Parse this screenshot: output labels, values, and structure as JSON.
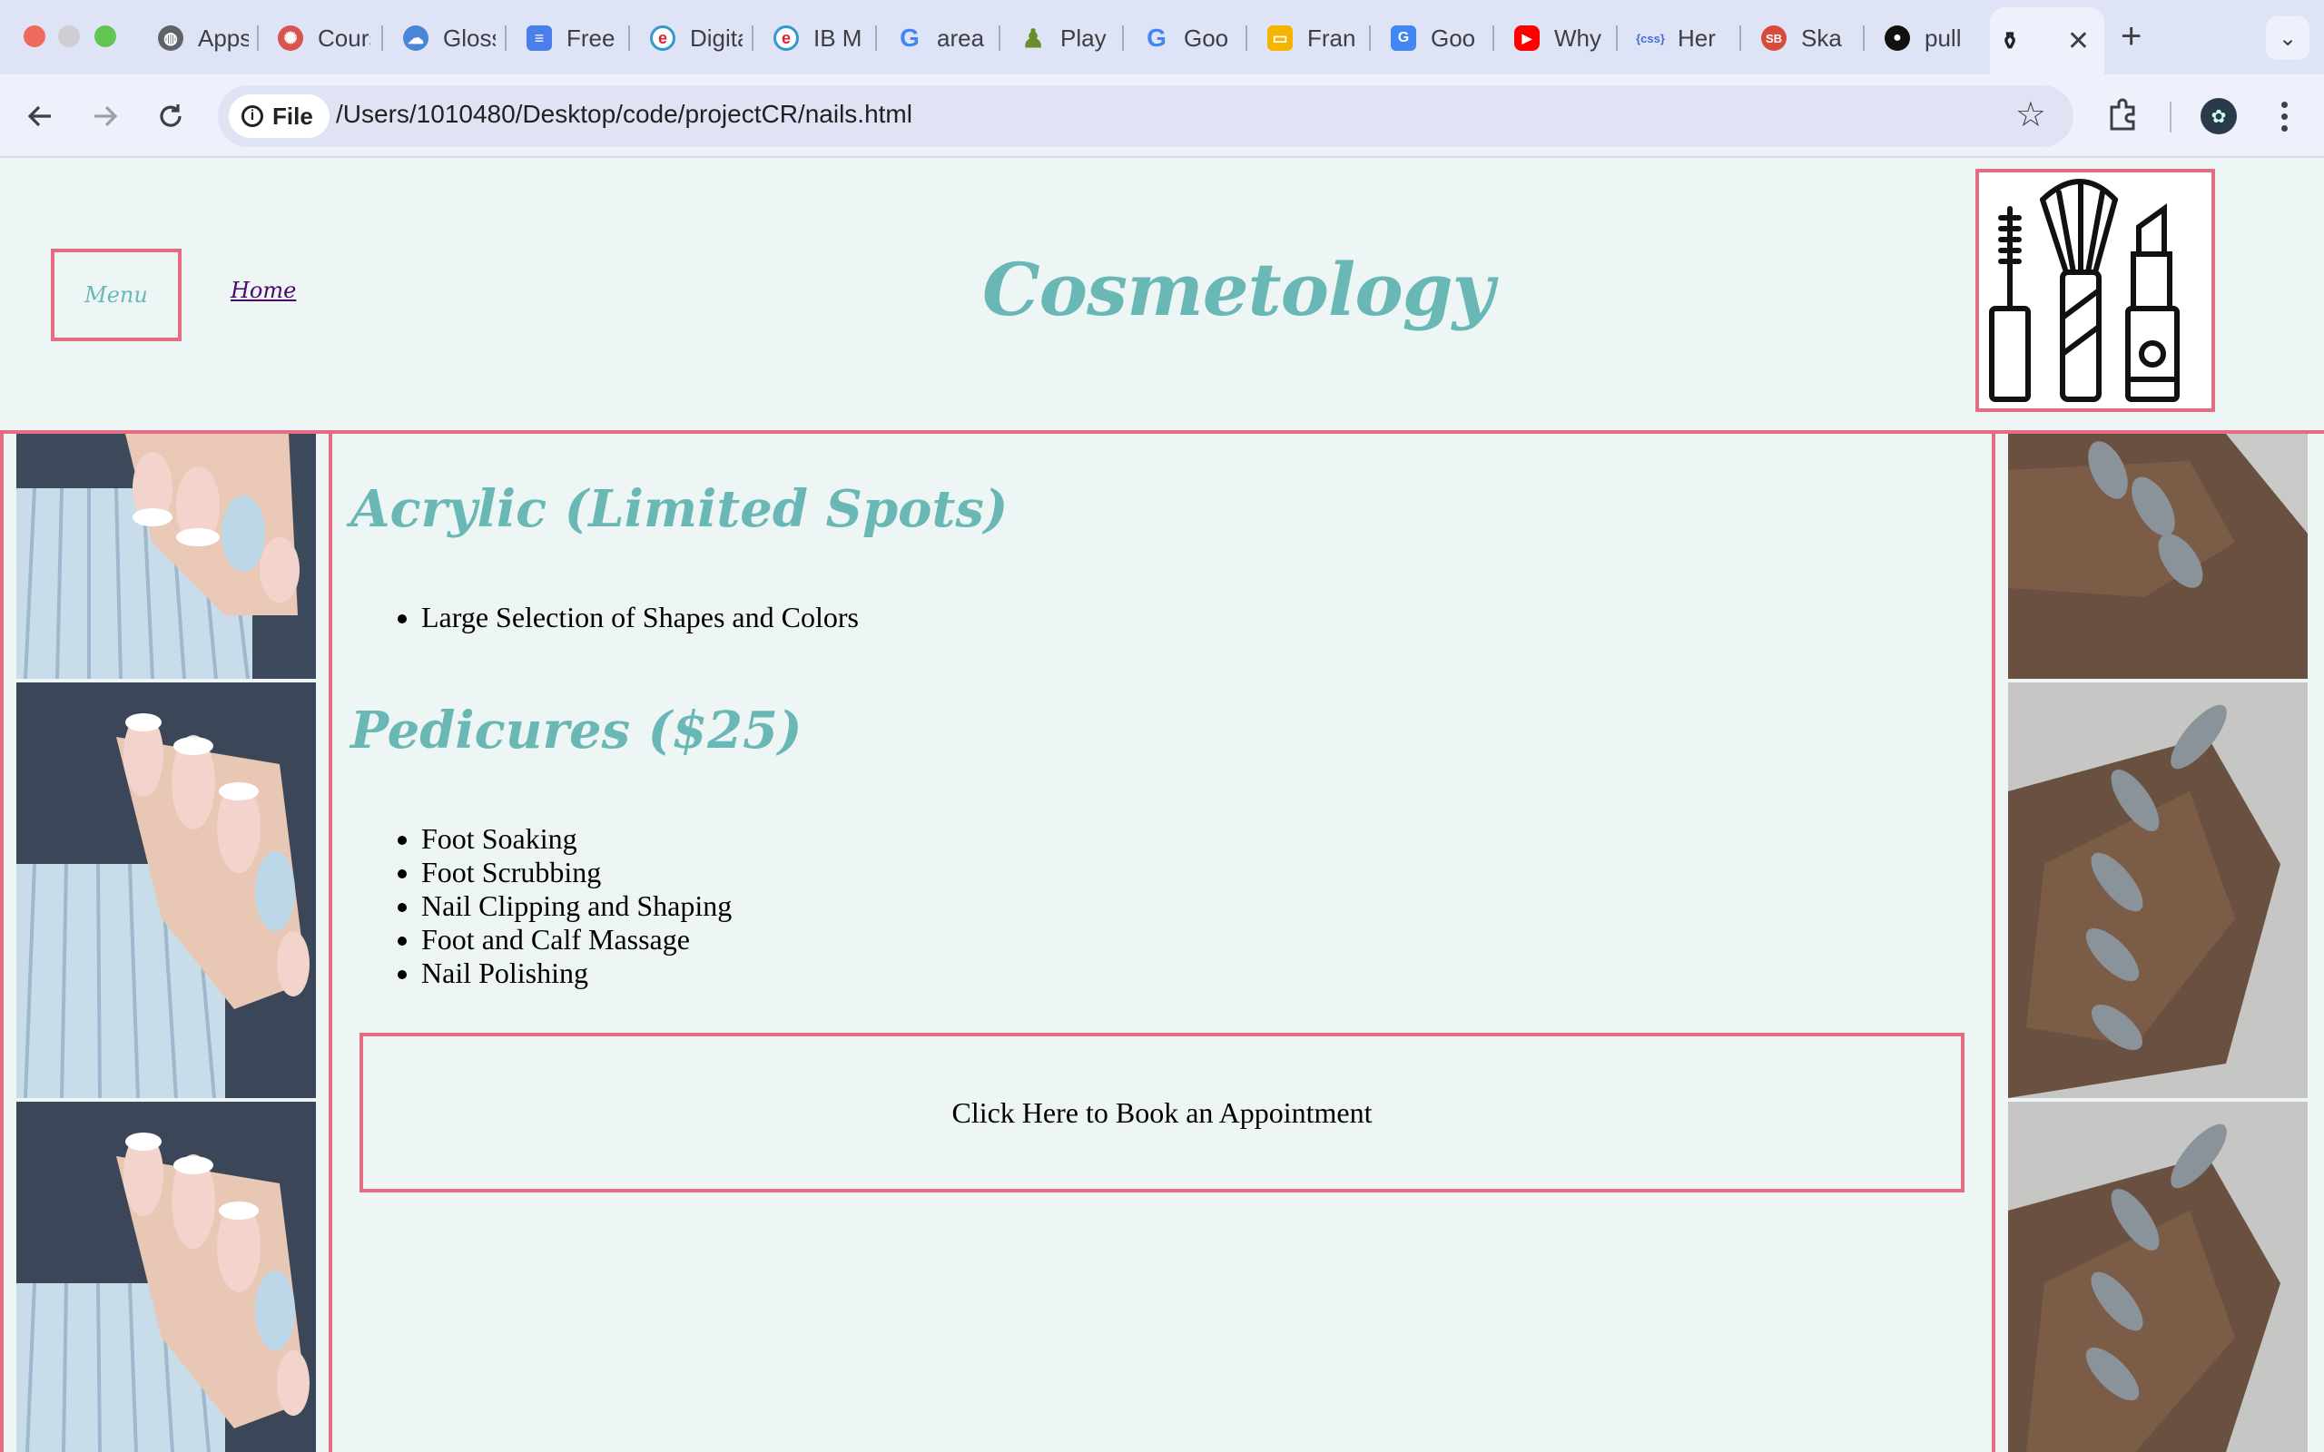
{
  "browser": {
    "tabs": [
      {
        "title": "Apps",
        "icon": "globe-icon"
      },
      {
        "title": "Course",
        "icon": "course-icon"
      },
      {
        "title": "Glossary",
        "icon": "cloud-icon"
      },
      {
        "title": "Free",
        "icon": "docs-icon"
      },
      {
        "title": "Digital",
        "icon": "e-icon"
      },
      {
        "title": "IB M",
        "icon": "e-icon"
      },
      {
        "title": "area",
        "icon": "google-icon"
      },
      {
        "title": "Play",
        "icon": "chess-icon"
      },
      {
        "title": "Goo",
        "icon": "google-icon"
      },
      {
        "title": "Fran",
        "icon": "slides-icon"
      },
      {
        "title": "Goo",
        "icon": "translate-icon"
      },
      {
        "title": "Why",
        "icon": "youtube-icon"
      },
      {
        "title": "Her",
        "icon": "css-icon"
      },
      {
        "title": "Ska",
        "icon": "sb-icon"
      },
      {
        "title": "pull",
        "icon": "github-icon"
      }
    ],
    "active_tab_icon": "cosmetics-icon",
    "address": {
      "scheme_label": "File",
      "url": "/Users/1010480/Desktop/code/projectCR/nails.html"
    }
  },
  "site": {
    "menu_label": "Menu",
    "home_link": "Home",
    "title": "Cosmetology",
    "logo_icon": "cosmetics-logo-icon"
  },
  "services": {
    "acrylic": {
      "heading": "Acrylic (Limited Spots)",
      "items": [
        "Large Selection of Shapes and Colors"
      ]
    },
    "pedicures": {
      "heading": "Pedicures ($25)",
      "items": [
        "Foot Soaking",
        "Foot Scrubbing",
        "Nail Clipping and Shaping",
        "Foot and Calf Massage",
        "Nail Polishing"
      ]
    }
  },
  "booking": {
    "label": "Click Here to Book an Appointment"
  },
  "colors": {
    "accent_border": "#e46d83",
    "script_teal": "#6ab8b6",
    "page_bg": "#eef5f5"
  }
}
